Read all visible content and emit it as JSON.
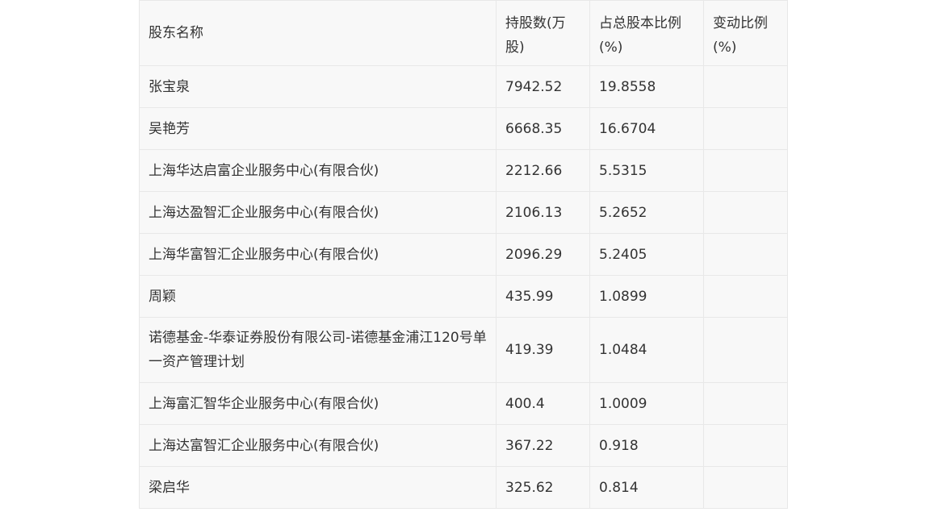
{
  "table": {
    "headers": {
      "name": "股东名称",
      "shares": "持股数(万股)",
      "ratio": "占总股本比例(%)",
      "change": "变动比例(%)"
    },
    "rows": [
      {
        "name": "张宝泉",
        "shares": "7942.52",
        "ratio": "19.8558",
        "change": ""
      },
      {
        "name": "吴艳芳",
        "shares": "6668.35",
        "ratio": "16.6704",
        "change": ""
      },
      {
        "name": "上海华达启富企业服务中心(有限合伙)",
        "shares": "2212.66",
        "ratio": "5.5315",
        "change": ""
      },
      {
        "name": "上海达盈智汇企业服务中心(有限合伙)",
        "shares": "2106.13",
        "ratio": "5.2652",
        "change": ""
      },
      {
        "name": "上海华富智汇企业服务中心(有限合伙)",
        "shares": "2096.29",
        "ratio": "5.2405",
        "change": ""
      },
      {
        "name": "周颖",
        "shares": "435.99",
        "ratio": "1.0899",
        "change": ""
      },
      {
        "name": "诺德基金-华泰证券股份有限公司-诺德基金浦江120号单一资产管理计划",
        "shares": "419.39",
        "ratio": "1.0484",
        "change": ""
      },
      {
        "name": "上海富汇智华企业服务中心(有限合伙)",
        "shares": "400.4",
        "ratio": "1.0009",
        "change": ""
      },
      {
        "name": "上海达富智汇企业服务中心(有限合伙)",
        "shares": "367.22",
        "ratio": "0.918",
        "change": ""
      },
      {
        "name": "梁启华",
        "shares": "325.62",
        "ratio": "0.814",
        "change": ""
      }
    ]
  }
}
